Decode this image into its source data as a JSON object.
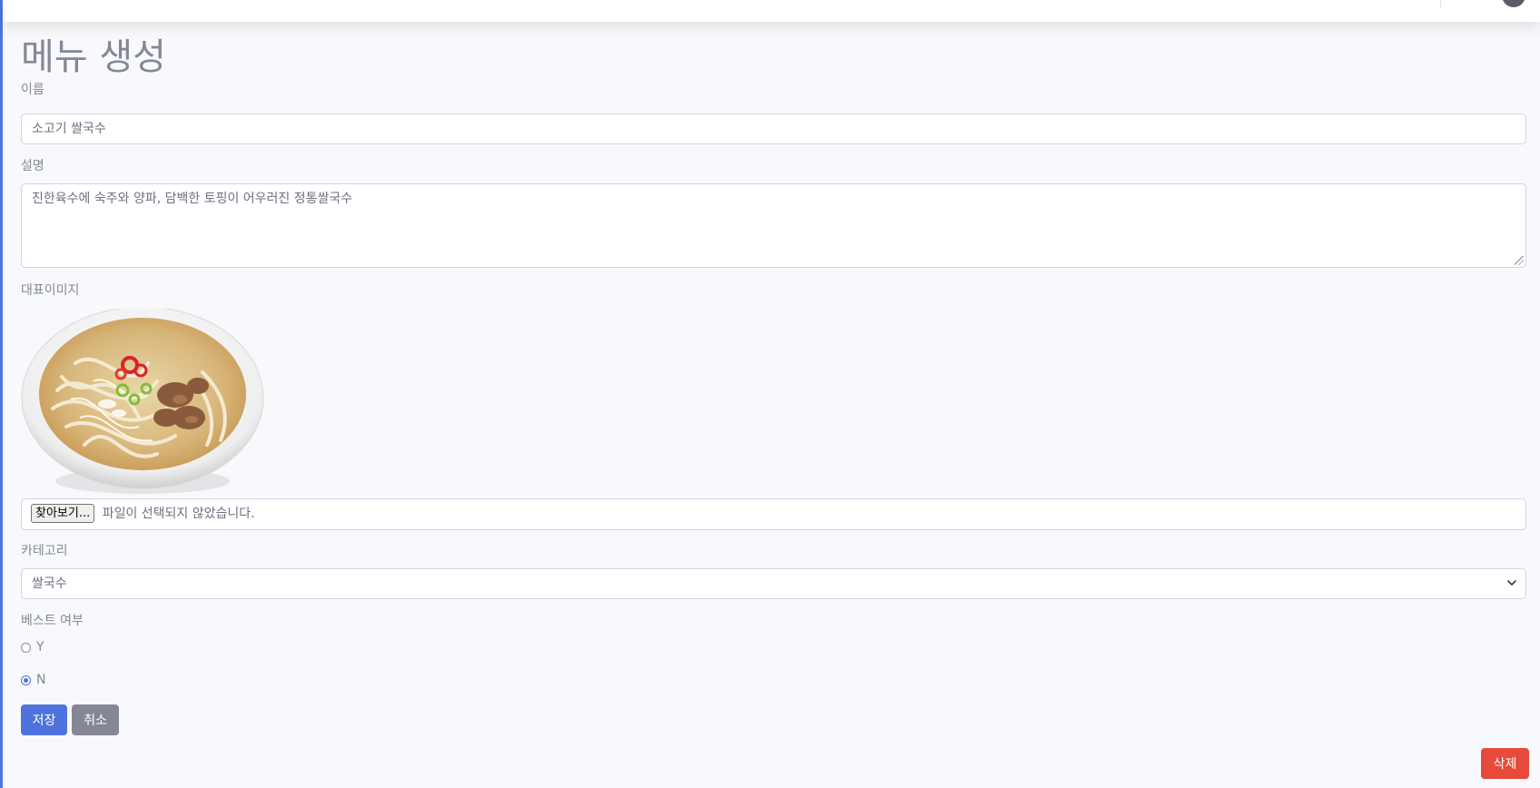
{
  "page": {
    "title": "메뉴 생성"
  },
  "form": {
    "name": {
      "label": "이름",
      "value": "소고기 쌀국수"
    },
    "description": {
      "label": "설명",
      "value": "진한육수에 숙주와 양파, 담백한 토핑이 어우러진 정통쌀국수"
    },
    "image": {
      "label": "대표이미지",
      "browse_label": "찾아보기...",
      "file_status": "파일이 선택되지 않았습니다."
    },
    "category": {
      "label": "카테고리",
      "selected": "쌀국수"
    },
    "best": {
      "label": "베스트 여부",
      "options": [
        {
          "label": "Y",
          "checked": false
        },
        {
          "label": "N",
          "checked": true
        }
      ]
    }
  },
  "actions": {
    "save_label": "저장",
    "cancel_label": "취소",
    "delete_label": "삭제"
  },
  "colors": {
    "primary": "#4e73df",
    "secondary": "#858796",
    "danger": "#e74a3b",
    "background": "#f8f9fc"
  }
}
